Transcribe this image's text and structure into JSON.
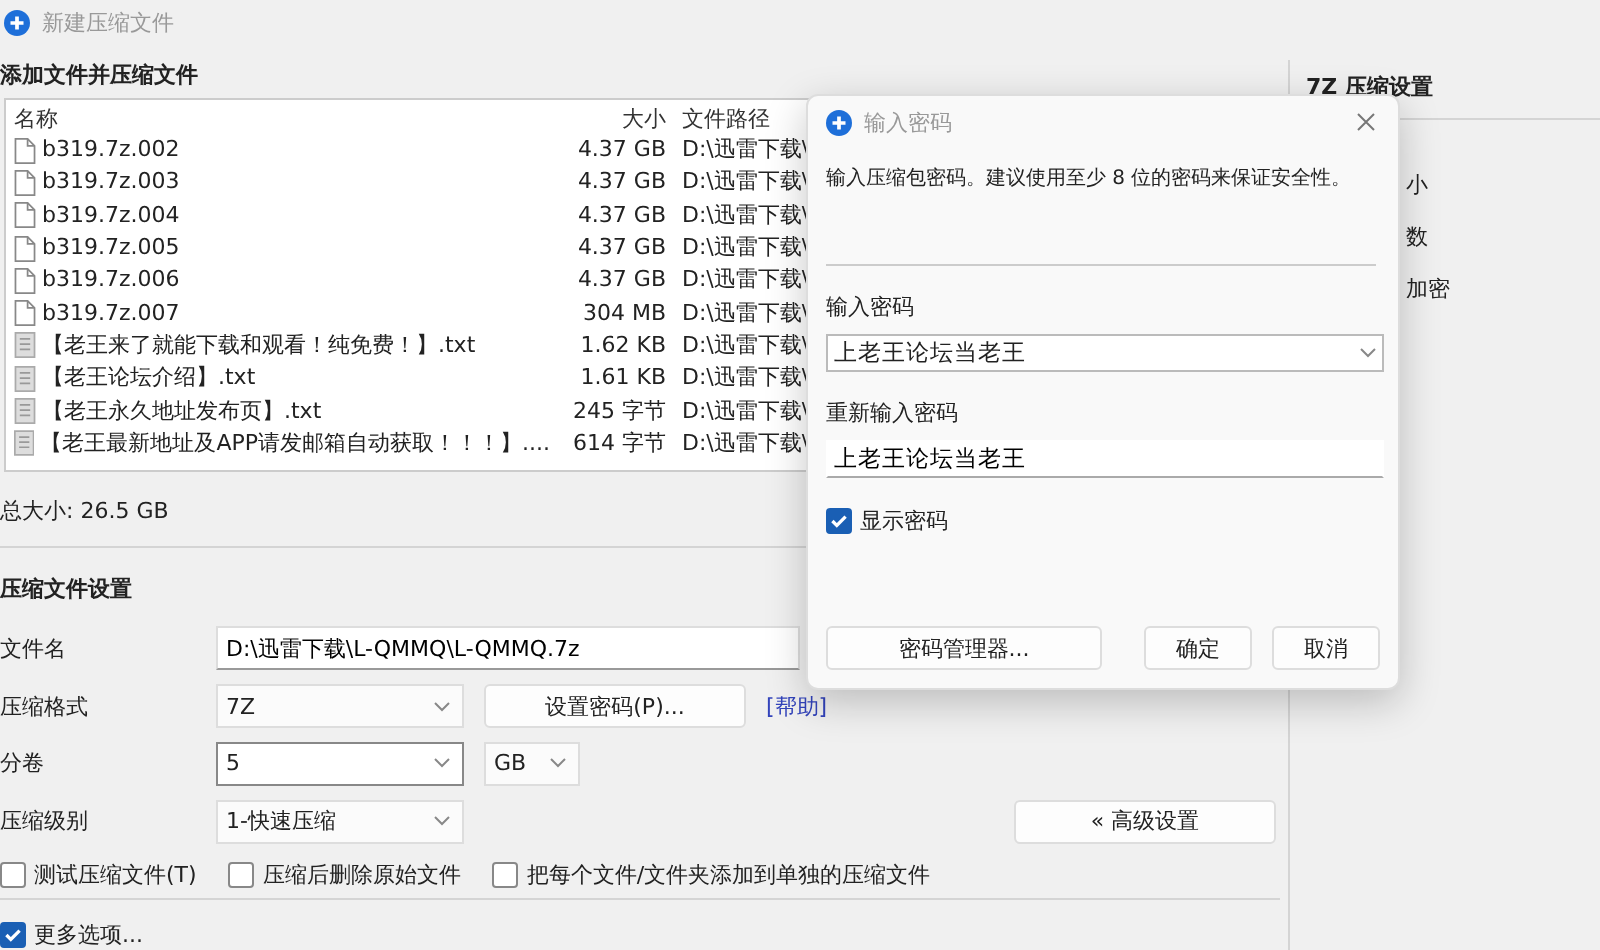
{
  "window": {
    "title": "新建压缩文件"
  },
  "files_section": {
    "title": "添加文件并压缩文件",
    "columns": [
      "名称",
      "大小",
      "文件路径"
    ],
    "rows": [
      {
        "kind": "archive",
        "name": "b319.7z.002",
        "size": "4.37 GB",
        "path": "D:\\迅雷下载\\"
      },
      {
        "kind": "archive",
        "name": "b319.7z.003",
        "size": "4.37 GB",
        "path": "D:\\迅雷下载\\"
      },
      {
        "kind": "archive",
        "name": "b319.7z.004",
        "size": "4.37 GB",
        "path": "D:\\迅雷下载\\"
      },
      {
        "kind": "archive",
        "name": "b319.7z.005",
        "size": "4.37 GB",
        "path": "D:\\迅雷下载\\"
      },
      {
        "kind": "archive",
        "name": "b319.7z.006",
        "size": "4.37 GB",
        "path": "D:\\迅雷下载\\"
      },
      {
        "kind": "archive",
        "name": "b319.7z.007",
        "size": "304 MB",
        "path": "D:\\迅雷下载\\"
      },
      {
        "kind": "text",
        "name": "【老王来了就能下载和观看！纯免费！】.txt",
        "size": "1.62 KB",
        "path": "D:\\迅雷下载\\"
      },
      {
        "kind": "text",
        "name": "【老王论坛介绍】.txt",
        "size": "1.61 KB",
        "path": "D:\\迅雷下载\\"
      },
      {
        "kind": "text",
        "name": "【老王永久地址发布页】.txt",
        "size": "245 字节",
        "path": "D:\\迅雷下载\\"
      },
      {
        "kind": "text",
        "name": "【老王最新地址及APP请发邮箱自动获取！！！】....",
        "size": "614 字节",
        "path": "D:\\迅雷下载\\"
      }
    ],
    "total": "总大小: 26.5 GB"
  },
  "settings": {
    "title": "压缩文件设置",
    "filename": {
      "label": "文件名",
      "value": "D:\\迅雷下载\\L-QMMQ\\L-QMMQ.7z"
    },
    "format": {
      "label": "压缩格式",
      "value": "7Z",
      "button": "设置密码(P)...",
      "help": "[帮助]"
    },
    "volume": {
      "label": "分卷",
      "value": "5",
      "unit": "GB"
    },
    "level": {
      "label": "压缩级别",
      "value": "1-快速压缩",
      "button": "« 高级设置"
    },
    "options": [
      {
        "label": "测试压缩文件(T)",
        "checked": false
      },
      {
        "label": "压缩后删除原始文件",
        "checked": false
      },
      {
        "label": "把每个文件/文件夹添加到单独的压缩文件",
        "checked": false
      }
    ],
    "more": {
      "label": "更多选项...",
      "checked": true
    }
  },
  "side_panel": {
    "title": "7Z 压缩设置",
    "items": [
      "小",
      "数",
      "加密"
    ]
  },
  "dialog": {
    "title": "输入密码",
    "message": "输入压缩包密码。建议使用至少 8 位的密码来保证安全性。",
    "password_label": "输入密码",
    "password": "上老王论坛当老王",
    "repeat_label": "重新输入密码",
    "repeat": "上老王论坛当老王",
    "show_password": {
      "label": "显示密码",
      "checked": true
    },
    "buttons": [
      "密码管理器...",
      "确定",
      "取消"
    ]
  }
}
